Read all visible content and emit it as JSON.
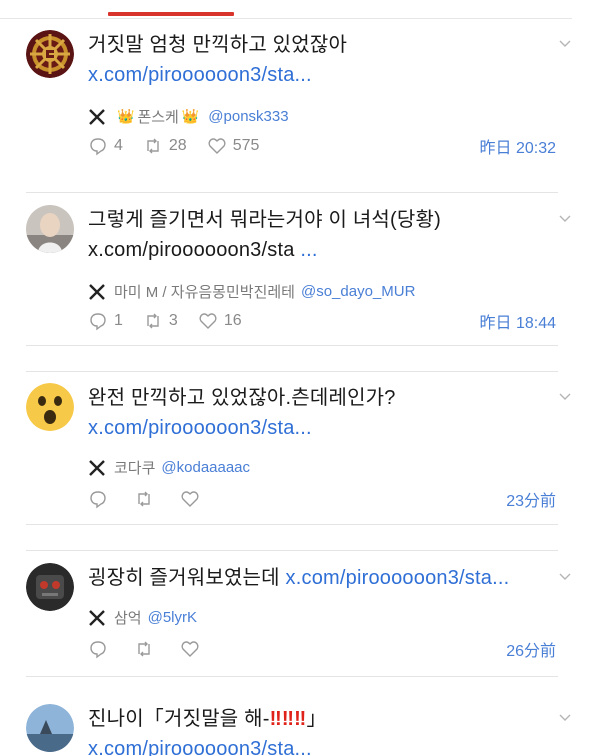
{
  "tweets": [
    {
      "text": "거짓말 엄청 만끽하고 있었잖아",
      "link": "x.com/piroooooon3/sta...",
      "author_name": "폰스케",
      "author_handle": "@ponsk333",
      "replies": "4",
      "retweets": "28",
      "likes": "575",
      "time": "昨日 20:32"
    },
    {
      "text": "그렇게 즐기면서 뭐라는거야 이 녀석(당황)",
      "link": "x.com/piroooooon3/sta",
      "link_suffix": "...",
      "author_name": "마미 M / 자유음몽민박진레테",
      "author_handle": "@so_dayo_MUR",
      "replies": "1",
      "retweets": "3",
      "likes": "16",
      "time": "昨日 18:44"
    },
    {
      "text": "완전 만끽하고 있었잖아.츤데레인가?",
      "link": "x.com/piroooooon3/sta...",
      "author_name": "코다쿠",
      "author_handle": "@kodaaaaac",
      "time": "23分前"
    },
    {
      "text": "굉장히 즐거워보였는데",
      "link": "x.com/piroooooon3/sta...",
      "author_name": "삼억",
      "author_handle": "@5lyrK",
      "time": "26分前"
    },
    {
      "text_open": "진나이「거짓말을 해-",
      "text_excl": "‼‼‼",
      "text_close": "」",
      "link": "x.com/piroooooon3/sta..."
    }
  ],
  "icons": {
    "reply": "reply-icon",
    "retweet": "retweet-icon",
    "like": "heart-icon",
    "menu": "chevron-down-icon",
    "source": "x-logo-icon",
    "crown": "👑"
  },
  "colors": {
    "link": "#2f6fd6",
    "handle": "#4a7fd6",
    "accent": "#d9342b"
  }
}
